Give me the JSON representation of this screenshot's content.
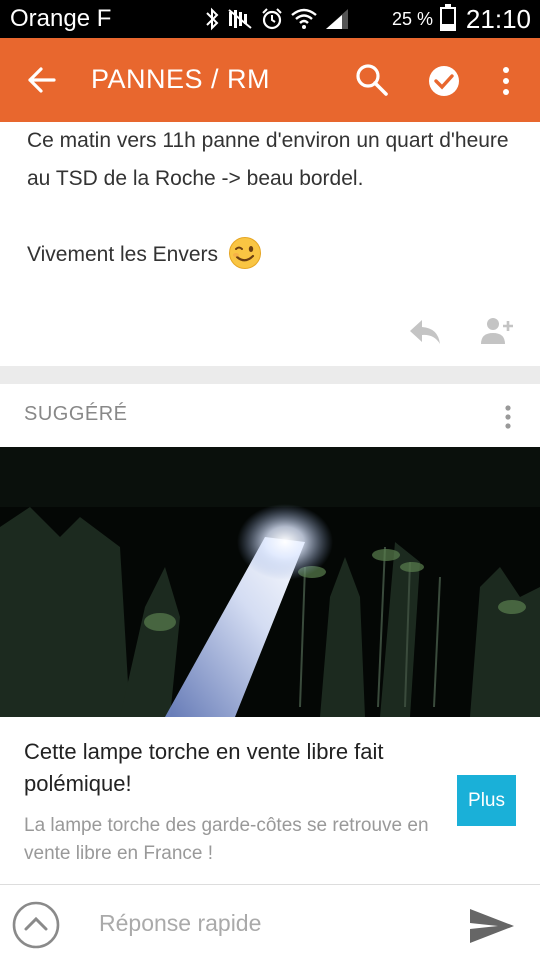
{
  "status_bar": {
    "carrier": "Orange F",
    "battery_percent": "25 %",
    "battery_level": 0.25,
    "time": "21:10",
    "icons": [
      "bluetooth-icon",
      "mute-icon",
      "alarm-icon",
      "wifi-icon",
      "signal-icon",
      "battery-icon"
    ]
  },
  "app_bar": {
    "title": "PANNES / RM",
    "icons": [
      "back-arrow-icon",
      "search-icon",
      "check-circle-icon",
      "more-vert-icon"
    ],
    "color": "#e8672e"
  },
  "post": {
    "paragraph_1": "Ce matin vers 11h panne d'environ un quart d'heure au TSD de la Roche -> beau bordel.",
    "paragraph_2": "Vivement les Envers",
    "emoji": "winking-face-icon",
    "actions": [
      "reply-icon",
      "add-person-icon"
    ]
  },
  "suggested": {
    "label": "SUGGÉRÉ",
    "headline": "Cette lampe torche en vente libre fait polémique!",
    "description": "La lampe torche des garde-côtes se retrouve en vente libre en France !",
    "button": "Plus",
    "button_color": "#1ab0d8"
  },
  "bottom_bar": {
    "placeholder": "Réponse rapide",
    "icons": [
      "expand-up-icon",
      "send-icon"
    ]
  }
}
